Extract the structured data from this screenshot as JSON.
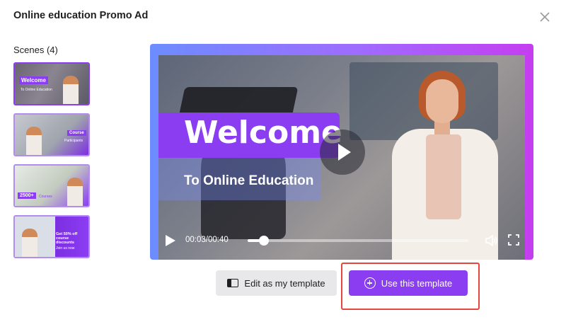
{
  "dialog": {
    "title": "Online education Promo Ad",
    "close_icon": "close-icon"
  },
  "scenes": {
    "label": "Scenes (4)",
    "selected_index": 0,
    "thumbnails": [
      {
        "banner": "Welcome",
        "sub": "To Online Education"
      },
      {
        "banner": "Course",
        "sub": "Participants"
      },
      {
        "banner": "2500+",
        "sub": "Courses"
      },
      {
        "banner": "Get 50% off course discounts",
        "sub": "Join us now"
      }
    ]
  },
  "player": {
    "headline": "Welcome",
    "subheadline": "To Online Education",
    "time": "00:03/00:40",
    "progress_fraction": 0.075,
    "icons": [
      "play-icon",
      "volume-icon",
      "fullscreen-icon"
    ]
  },
  "actions": {
    "edit_label": "Edit as my template",
    "use_label": "Use this template",
    "accent_color": "#8b3df2",
    "highlight_color": "#e3463a"
  }
}
